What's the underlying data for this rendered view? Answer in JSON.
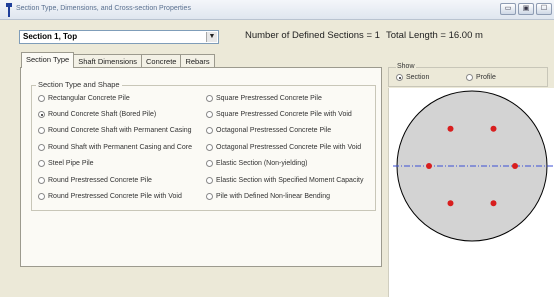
{
  "window": {
    "title": "Section Type, Dimensions, and Cross-section Properties",
    "buttons": [
      "▭",
      "▣",
      "☐"
    ]
  },
  "header": {
    "section_value": "Section 1, Top",
    "num_defined": "Number of Defined Sections = 1",
    "total_length": "Total Length = 16.00 m"
  },
  "tabs": [
    {
      "label": "Section Type",
      "active": true
    },
    {
      "label": "Shaft Dimensions",
      "active": false
    },
    {
      "label": "Concrete",
      "active": false
    },
    {
      "label": "Rebars",
      "active": false
    }
  ],
  "section_type": {
    "legend": "Section Type and Shape",
    "left_options": [
      {
        "label": "Rectangular Concrete Pile",
        "selected": false
      },
      {
        "label": "Round Concrete Shaft (Bored Pile)",
        "selected": true
      },
      {
        "label": "Round Concrete Shaft with Permanent Casing",
        "selected": false
      },
      {
        "label": "Round Shaft with Permanent Casing and Core",
        "selected": false
      },
      {
        "label": "Steel Pipe Pile",
        "selected": false
      },
      {
        "label": "Round Prestressed Concrete Pile",
        "selected": false
      },
      {
        "label": "Round Prestressed Concrete Pile with Void",
        "selected": false
      }
    ],
    "right_options": [
      {
        "label": "Square Prestressed Concrete Pile",
        "selected": false
      },
      {
        "label": "Square Prestressed Concrete Pile with Void",
        "selected": false
      },
      {
        "label": "Octagonal Prestressed Concrete Pile",
        "selected": false
      },
      {
        "label": "Octagonal Prestressed Concrete Pile with Void",
        "selected": false
      },
      {
        "label": "Elastic Section (Non-yielding)",
        "selected": false
      },
      {
        "label": "Elastic Section with Specified Moment Capacity",
        "selected": false
      },
      {
        "label": "Pile with Defined Non-linear Bending",
        "selected": false
      }
    ]
  },
  "show": {
    "legend": "Show",
    "section_label": "Section",
    "profile_label": "Profile",
    "selected": "Section"
  },
  "preview": {
    "fill_color": "#d3d3d3",
    "outline_color": "#000000",
    "axis_color": "#3b4fd6",
    "rebar_color": "#d81e1e",
    "rebar_count": 6
  }
}
